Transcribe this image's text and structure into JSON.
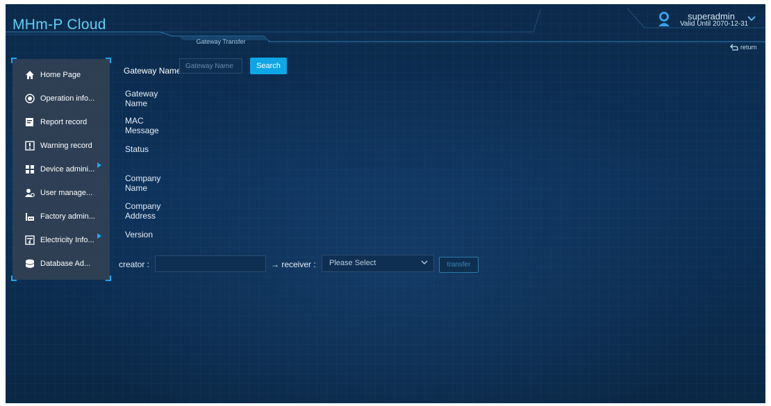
{
  "header": {
    "app_title": "MHm-P Cloud",
    "page_tab": "Gateway Transfer",
    "user": {
      "username": "superadmin",
      "valid_until": "Valid Until 2070-12-31"
    },
    "return_label": "return"
  },
  "sidebar": {
    "items": [
      {
        "label": "Home Page",
        "icon": "home-icon",
        "has_submenu": false
      },
      {
        "label": "Operation info...",
        "icon": "operation-icon",
        "has_submenu": false
      },
      {
        "label": "Report record",
        "icon": "report-icon",
        "has_submenu": false
      },
      {
        "label": "Warning record",
        "icon": "warning-icon",
        "has_submenu": false
      },
      {
        "label": "Device admini...",
        "icon": "device-icon",
        "has_submenu": true
      },
      {
        "label": "User manage...",
        "icon": "user-icon",
        "has_submenu": false
      },
      {
        "label": "Factory admin...",
        "icon": "factory-icon",
        "has_submenu": false
      },
      {
        "label": "Electricity Info...",
        "icon": "electricity-icon",
        "has_submenu": true
      },
      {
        "label": "Database Ad...",
        "icon": "database-icon",
        "has_submenu": false
      }
    ]
  },
  "search": {
    "label": "Gateway Name",
    "placeholder": "Gateway Name",
    "value": "",
    "button_label": "Search"
  },
  "details": {
    "gateway_name": [
      "Gateway",
      "Name"
    ],
    "mac_message": [
      "MAC",
      "Message"
    ],
    "status": "Status",
    "company_name": [
      "Company",
      "Name"
    ],
    "company_address": [
      "Company",
      "Address"
    ],
    "version": "Version"
  },
  "transfer": {
    "creator_label": "creator :",
    "creator_value": "",
    "receiver_label": "→ receiver :",
    "receiver_selected": "Please Select",
    "button_label": "transfer"
  },
  "colors": {
    "accent": "#0fa6e6",
    "title": "#5fd0f5",
    "background": "#0c2a4a",
    "sidebar": "#384454"
  }
}
